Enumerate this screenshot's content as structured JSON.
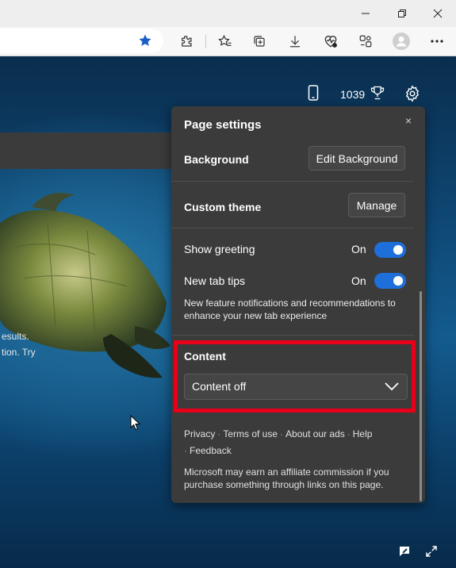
{
  "browser": {
    "window_controls": {
      "minimize": "minimize-icon",
      "restore": "restore-icon",
      "close": "close-icon"
    },
    "toolbar_icons": [
      "favorite-star-icon",
      "extensions-icon",
      "favorites-icon",
      "collections-icon",
      "downloads-icon",
      "browser-essentials-icon",
      "copilot-icon",
      "profile-icon",
      "more-icon"
    ]
  },
  "newtab": {
    "rewards_points": "1039",
    "side_text_1": "esults.",
    "side_text_2": "tion. Try"
  },
  "panel": {
    "title": "Page settings",
    "close_label": "×",
    "background_label": "Background",
    "edit_background_button": "Edit Background",
    "custom_theme_label": "Custom theme",
    "manage_button": "Manage",
    "show_greeting_label": "Show greeting",
    "show_greeting_state": "On",
    "new_tab_tips_label": "New tab tips",
    "new_tab_tips_state": "On",
    "tips_description": "New feature notifications and recommendations to enhance your new tab experience",
    "content_label": "Content",
    "content_value": "Content off",
    "links": {
      "privacy": "Privacy",
      "terms": "Terms of use",
      "about_ads": "About our ads",
      "help": "Help",
      "feedback": "Feedback"
    },
    "link_separator": "·",
    "affiliate_text": "Microsoft may earn an affiliate commission if you purchase something through links on this page."
  },
  "colors": {
    "accent": "#1e6fd9",
    "highlight": "#e8001b",
    "panel_bg": "#3b3b3b"
  }
}
